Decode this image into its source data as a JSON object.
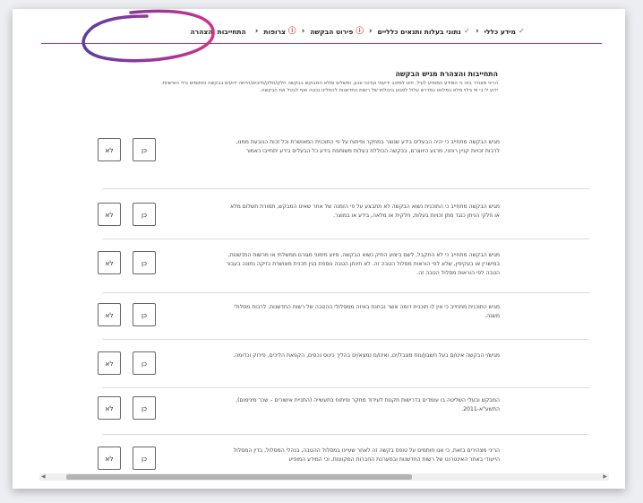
{
  "stepper": {
    "steps": [
      {
        "label": "מידע כללי",
        "status": "done"
      },
      {
        "label": "נתוני בעלות ותנאים כלליים",
        "status": "done"
      },
      {
        "label": "פירוט הבקשה",
        "status": "error"
      },
      {
        "label": "צרופות",
        "status": "error"
      },
      {
        "label": "התחייבות והצהרה",
        "status": "current"
      }
    ]
  },
  "icons": {
    "done": "check-circle-icon",
    "error": "alert-circle-icon",
    "separator": "chevron-left-icon"
  },
  "colors": {
    "accent": "#c23b6d",
    "done": "#3f9e45",
    "error": "#d9393d",
    "annotation": "#b03a96"
  },
  "section": {
    "title": "התחייבות והצהרת מגיש הבקשה",
    "description": "הריני מצהיר בזה כי המידע המופיע לעיל, חינו למיטב ידיעתי ועדכני ונכון. ומשלים ומלא המבוקש בבקשה חלק/חלק/חייבים/הייתה ידועים בבקשה וחתומים בידי האישיות. ידוע לי כי אי גילוי מלא במלואו כמדרש עלול לפגוע ביכולתו של רשות החדשנות להחליט נכונה ואף לבטל את הבקשה."
  },
  "buttons": {
    "yes": "כן",
    "no": "לא"
  },
  "questions": [
    {
      "text": "מגיש הבקשה מתחייב כי יהיה הבעלים בידע שנוצר במחקר ופיתוח על פי התוכנית המאושרת וכל זכות הנובעת ממנו, לרבות זכויות קניין רוחני, מרגע היווצרם, בבקשה הכוללת בעלות משותפת בידע כל הבעלים בידע יתחייבו כאמור"
    },
    {
      "text": "מגיש הבקשה מתחייב כי התוכנית נשוא הבקשה לא תתבצע על פי הזמנה של אחר שאינו המבקש, תמורת תשלום מלא או חלקי הניתן כנגד מתן זכויות בעלות, חלקית או מלאה, בידע או במוצר."
    },
    {
      "text": "מגיש הבקשה מתחייב כי לא התקבל, לשם ביצוע התיק נשוא הבקשה, סיוע מימוני מגורם ממשלתי או מרשות החדשנות, במישרין או בעקיפין, שלא לפי הוראות מסלול הטבה זה. לא תינתן הטבה נוספת בגין תכנית מאושרת בזיקה נתונה בעבור הטבה לפי הוראות מסלול הטבה זה."
    },
    {
      "text": "מגיש התוכנית מתחייב כי אין לו תוכנית דומה אשר נבחנת באיזה ממסלולי ההטבה של רשות החדשנות, לרבות מסלולי משנה."
    },
    {
      "text": "מגיש/י הבקשה אינו/ם בעל חשבון/נות מוגבל/ים, ואינו/ם נמצא/ים בהליך כינוס נכסים, הקפאת הליכים, פירוק וכדומה."
    },
    {
      "text": "המבקש ובעלי השליטה בו עומדים בדרישות תקנות לעידוד מחקר ופיתוח בתעשייה (התניית אישורים – שכר מינימום), התשע\"א-2011."
    },
    {
      "text": "הריני מצהירים בזאת, כי אנו חותמים על טופס בקשה זה לאחר שעיינו במסלול ההטבה, בנהלי המסלול, בדין המסלול הייעודי באתר האינטרנט של רשות החדשנות ובמערכת החברות המקוונות, וכי המידע המופיע"
    }
  ]
}
